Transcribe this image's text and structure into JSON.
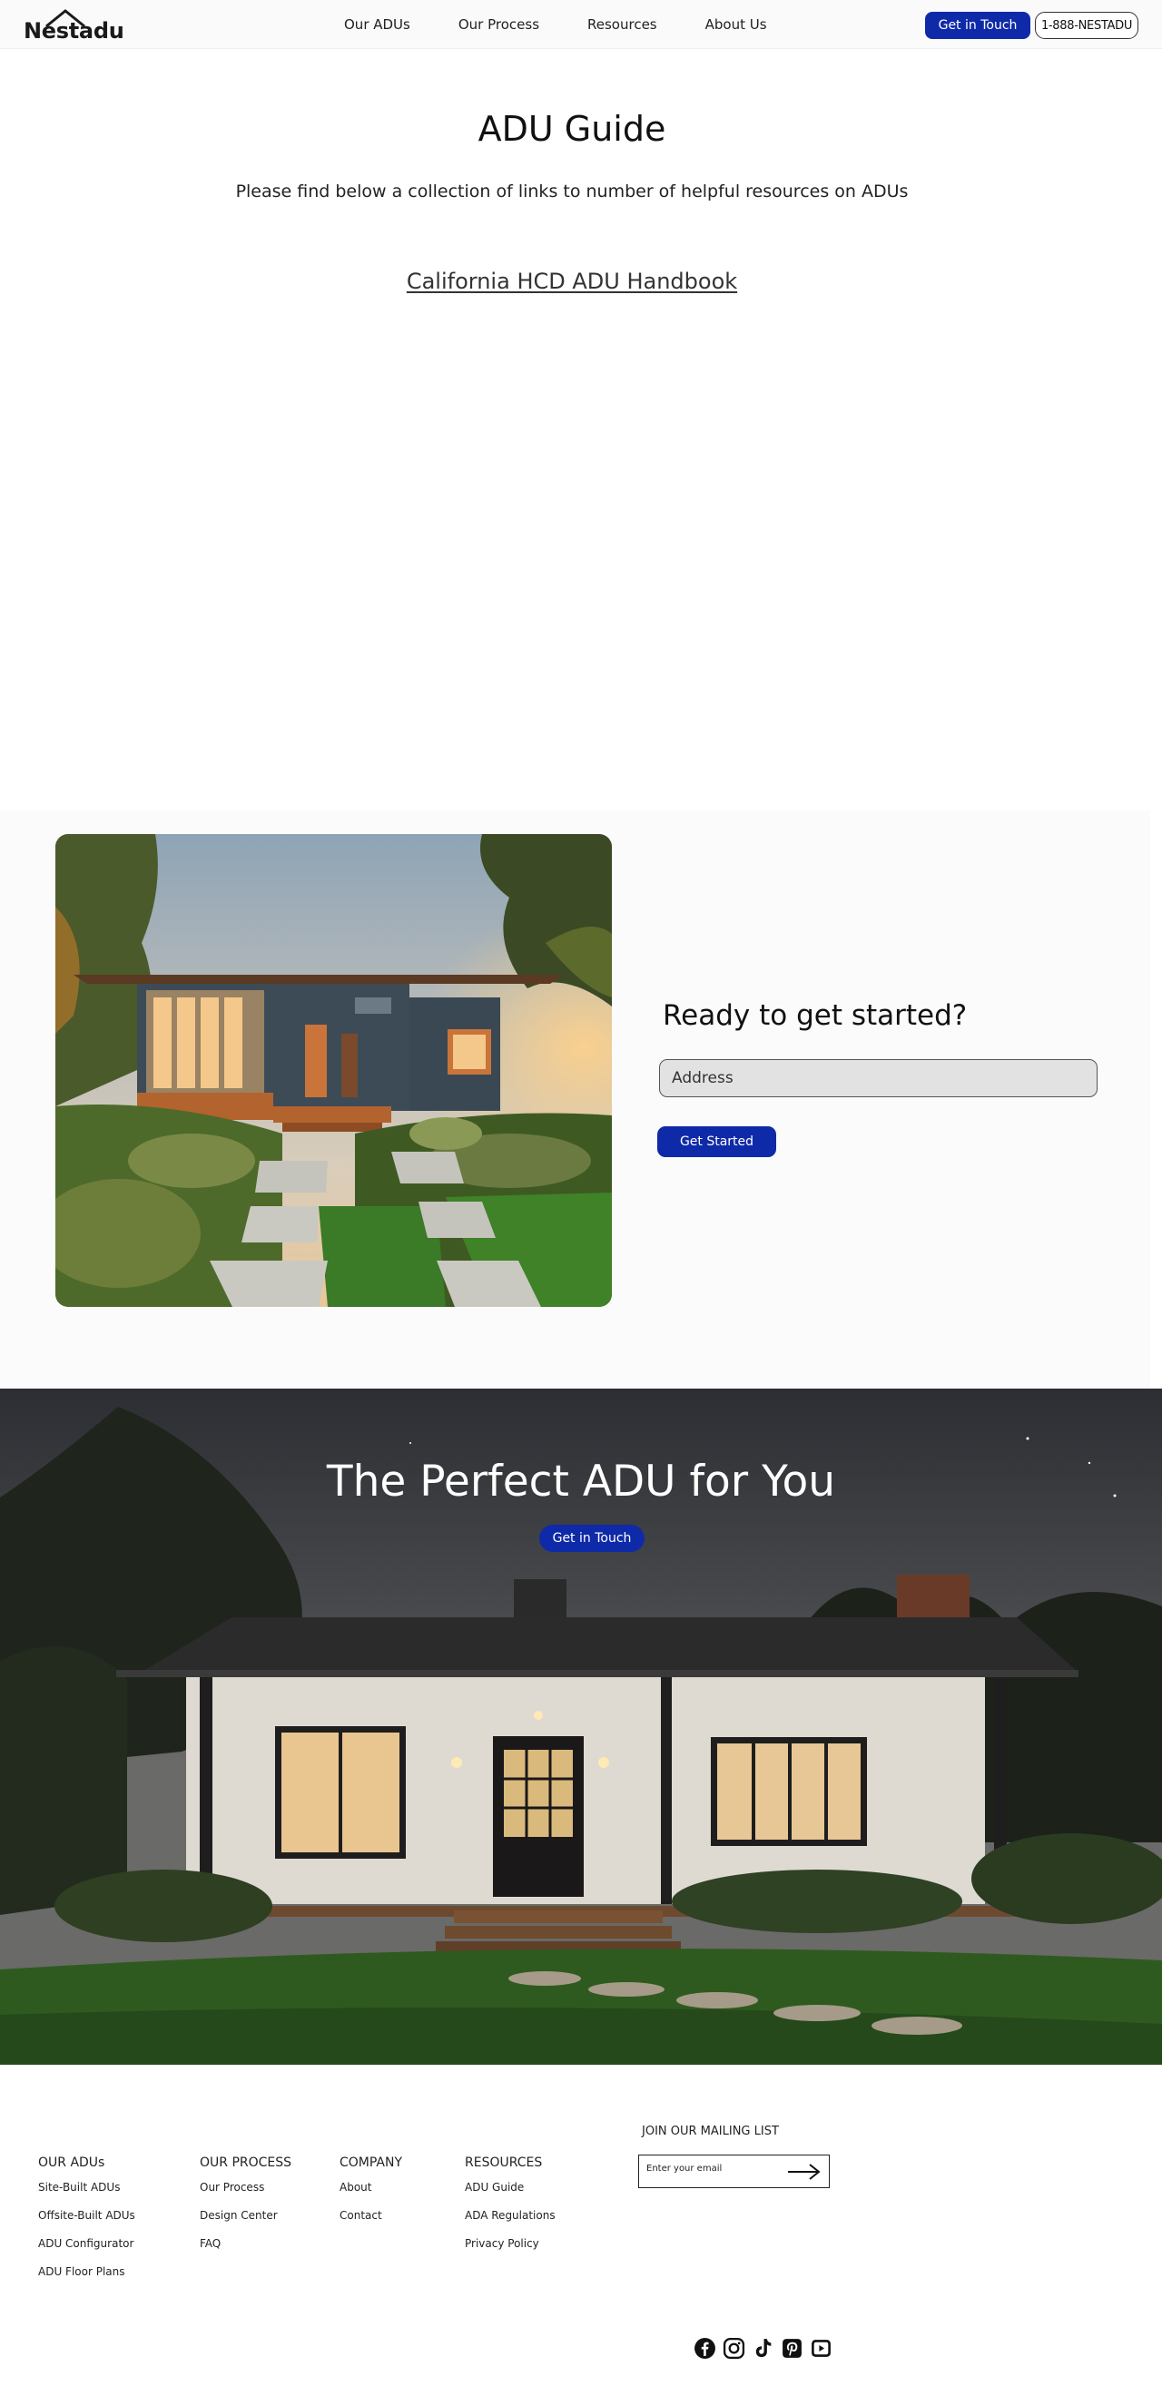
{
  "brand": {
    "name": "Nestadu"
  },
  "nav": {
    "links": [
      {
        "label": "Our ADUs"
      },
      {
        "label": "Our Process"
      },
      {
        "label": "Resources"
      },
      {
        "label": "About Us"
      }
    ],
    "cta_label": "Get in Touch",
    "phone_label": "1-888-NESTADU"
  },
  "guide": {
    "title": "ADU Guide",
    "subtitle": "Please find below a collection of links to number of helpful resources on ADUs",
    "link_label": "California HCD ADU Handbook"
  },
  "ready": {
    "title": "Ready to get started?",
    "address_placeholder": "Address",
    "button_label": "Get Started"
  },
  "hero": {
    "title": "The Perfect ADU for You",
    "button_label": "Get in Touch"
  },
  "footer": {
    "columns": [
      {
        "heading": "OUR ADUs",
        "items": [
          "Site-Built ADUs",
          "Offsite-Built ADUs",
          "ADU Configurator",
          "ADU Floor Plans"
        ]
      },
      {
        "heading": "OUR PROCESS",
        "items": [
          "Our Process",
          "Design Center",
          "FAQ"
        ]
      },
      {
        "heading": "COMPANY",
        "items": [
          "About",
          "Contact"
        ]
      },
      {
        "heading": "RESOURCES",
        "items": [
          "ADU Guide",
          "ADA Regulations",
          "Privacy Policy"
        ]
      }
    ],
    "mailing": {
      "label": "JOIN OUR MAILING LIST",
      "placeholder": "Enter your email"
    },
    "socials": [
      "facebook-icon",
      "instagram-icon",
      "tiktok-icon",
      "pinterest-icon",
      "youtube-icon"
    ]
  },
  "colors": {
    "accent": "#0f2aa8"
  }
}
